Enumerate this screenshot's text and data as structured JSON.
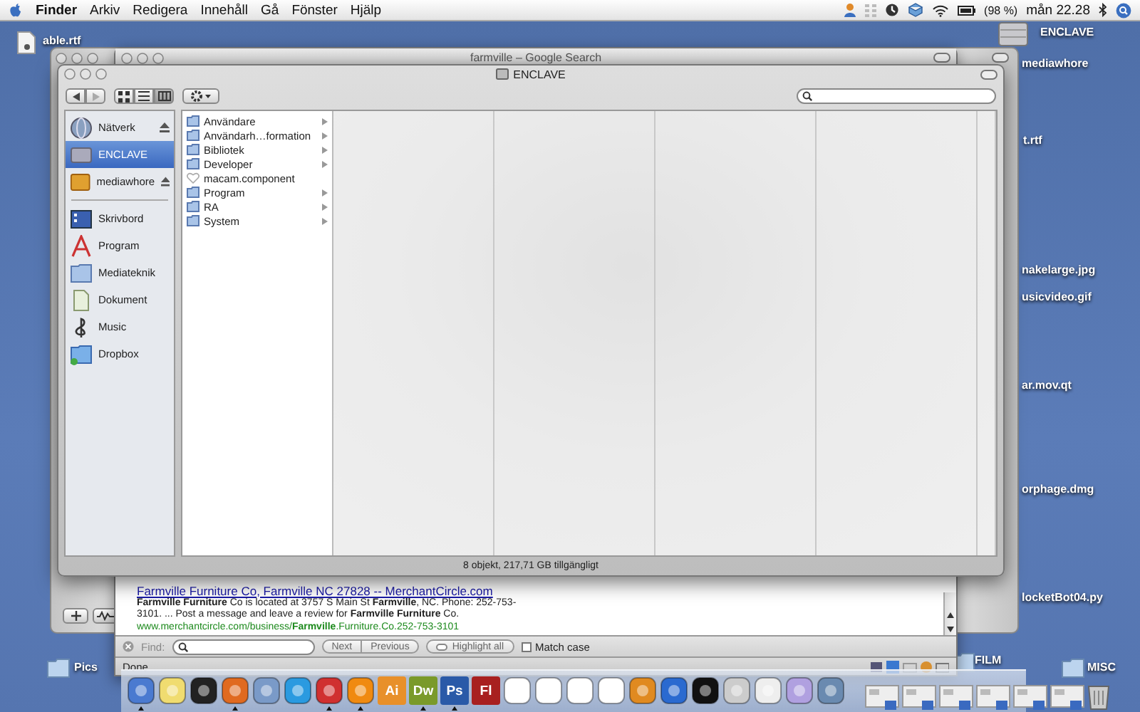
{
  "menu_bar": {
    "items": [
      {
        "label": "Finder",
        "kind": "app"
      },
      {
        "label": "Arkiv",
        "kind": "menu"
      },
      {
        "label": "Redigera",
        "kind": "menu"
      },
      {
        "label": "Innehåll",
        "kind": "menu"
      },
      {
        "label": "Gå",
        "kind": "menu"
      },
      {
        "label": "Fönster",
        "kind": "menu"
      },
      {
        "label": "Hjälp",
        "kind": "menu"
      }
    ],
    "battery": "(98 %)",
    "clock": "mån 22.28"
  },
  "desktop_icons": [
    {
      "label": "able.rtf",
      "kind": "document"
    },
    {
      "label": "ENCLAVE",
      "kind": "drive"
    },
    {
      "label": "mediawhore",
      "kind": "hidden"
    },
    {
      "label": "t.rtf",
      "kind": "hidden"
    },
    {
      "label": "nakelarge.jpg",
      "kind": "hidden"
    },
    {
      "label": "usicvideo.gif",
      "kind": "hidden"
    },
    {
      "label": "ar.mov.qt",
      "kind": "hidden"
    },
    {
      "label": "orphage.dmg",
      "kind": "hidden"
    },
    {
      "label": "locketBot04.py",
      "kind": "hidden"
    },
    {
      "label": "Pics",
      "kind": "folder"
    },
    {
      "label": "FILM",
      "kind": "folder"
    },
    {
      "label": "MISC",
      "kind": "folder"
    }
  ],
  "browser_window": {
    "title": "farmville – Google Search",
    "result": {
      "link": "Farmville Furniture Co, Farmville NC 27828 -- MerchantCircle.com",
      "snippet": "**Farmville Furniture** Co is located at 3757 S Main St **Farmville**, NC. Phone: 252-753-3101. ... Post a message and leave a review for **Farmville Furniture** Co.",
      "url": "www.merchantcircle.com/business/**Farmville**.Furniture.Co.252-753-3101"
    },
    "find_bar": {
      "label": "Find:",
      "buttons": [
        "Next",
        "Previous"
      ],
      "highlight": "Highlight all",
      "match_case": {
        "label": "Match case",
        "checked": false
      }
    },
    "status": "Done"
  },
  "finder_window": {
    "title": "ENCLAVE",
    "view_modes": [
      {
        "selected": false
      },
      {
        "selected": false
      },
      {
        "selected": true
      }
    ],
    "devices": [
      {
        "label": "Nätverk",
        "selected": false,
        "eject": true
      },
      {
        "label": "ENCLAVE",
        "selected": true,
        "eject": false
      },
      {
        "label": "mediawhore",
        "selected": false,
        "eject": true
      }
    ],
    "places": [
      {
        "label": "Skrivbord",
        "selected": false
      },
      {
        "label": "Program",
        "selected": false
      },
      {
        "label": "Mediateknik",
        "selected": false
      },
      {
        "label": "Dokument",
        "selected": false
      },
      {
        "label": "Music",
        "selected": false
      },
      {
        "label": "Dropbox",
        "selected": false
      }
    ],
    "column": [
      {
        "label": "Användare",
        "kind": "folder"
      },
      {
        "label": "Användarh…formation",
        "kind": "folder"
      },
      {
        "label": "Bibliotek",
        "kind": "folder"
      },
      {
        "label": "Developer",
        "kind": "folder"
      },
      {
        "label": "macam.component",
        "kind": "file"
      },
      {
        "label": "Program",
        "kind": "folder"
      },
      {
        "label": "RA",
        "kind": "folder"
      },
      {
        "label": "System",
        "kind": "folder"
      }
    ],
    "status": "8 objekt, 217,71 GB tillgängligt"
  },
  "dock": [
    {
      "kind": "icon",
      "running": true
    },
    {
      "kind": "icon",
      "running": false
    },
    {
      "kind": "icon",
      "running": false
    },
    {
      "kind": "icon",
      "running": true
    },
    {
      "kind": "icon",
      "running": false
    },
    {
      "kind": "icon",
      "running": false
    },
    {
      "kind": "icon",
      "running": true
    },
    {
      "kind": "icon",
      "running": true
    },
    {
      "kind": "text",
      "label": "Ai",
      "color": "#e8902a",
      "running": false
    },
    {
      "kind": "text",
      "label": "Dw",
      "color": "#7a9a2a",
      "running": true
    },
    {
      "kind": "text",
      "label": "Ps",
      "color": "#2a5aa8",
      "running": true
    },
    {
      "kind": "text",
      "label": "Fl",
      "color": "#a82020",
      "running": false
    },
    {
      "kind": "icon",
      "running": false
    },
    {
      "kind": "icon",
      "running": false
    },
    {
      "kind": "icon",
      "running": false
    },
    {
      "kind": "icon",
      "running": false
    },
    {
      "kind": "icon",
      "running": false
    },
    {
      "kind": "icon",
      "running": false
    },
    {
      "kind": "icon",
      "running": false
    },
    {
      "kind": "icon",
      "running": false
    },
    {
      "kind": "icon",
      "running": false
    },
    {
      "kind": "icon",
      "running": false
    },
    {
      "kind": "icon",
      "running": false
    },
    {
      "kind": "separator"
    },
    {
      "kind": "thumb"
    },
    {
      "kind": "thumb"
    },
    {
      "kind": "thumb"
    },
    {
      "kind": "thumb"
    },
    {
      "kind": "thumb"
    },
    {
      "kind": "thumb"
    },
    {
      "kind": "trash"
    }
  ]
}
